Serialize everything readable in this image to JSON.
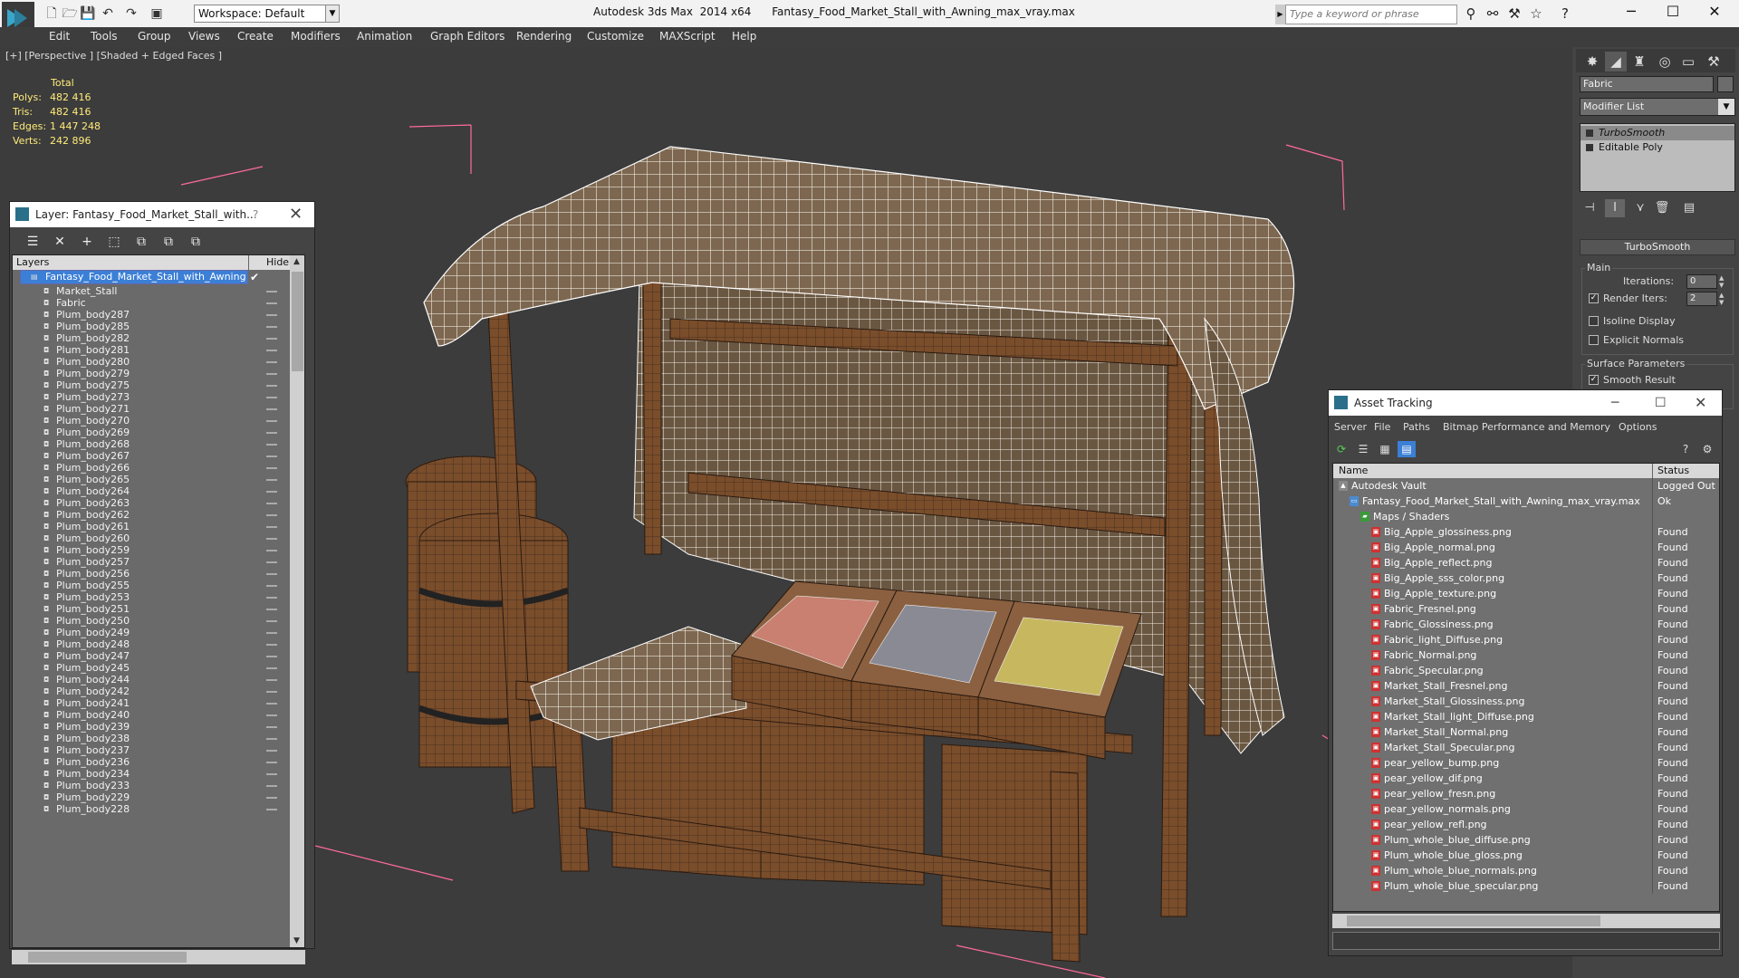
{
  "titlebar": {
    "workspace": "Workspace: Default",
    "app_title": "Autodesk 3ds Max  2014 x64",
    "file_title": "Fantasy_Food_Market_Stall_with_Awning_max_vray.max",
    "search_placeholder": "Type a keyword or phrase",
    "minimize": "─",
    "maximize": "☐",
    "close": "✕"
  },
  "menu": [
    "Edit",
    "Tools",
    "Group",
    "Views",
    "Create",
    "Modifiers",
    "Animation",
    "Graph Editors",
    "Rendering",
    "Customize",
    "MAXScript",
    "Help"
  ],
  "viewport": {
    "label": "[+] [Perspective ] [Shaded + Edged Faces ]",
    "stats_header": "Total",
    "stats": [
      {
        "k": "Polys:",
        "v": "482 416"
      },
      {
        "k": "Tris:",
        "v": "482 416"
      },
      {
        "k": "Edges:",
        "v": "1 447 248"
      },
      {
        "k": "Verts:",
        "v": "242 896"
      }
    ]
  },
  "command_panel": {
    "object_name": "Fabric",
    "modifier_list": "Modifier List",
    "stack": [
      {
        "label": "TurboSmooth",
        "selected": true
      },
      {
        "label": "Editable Poly",
        "selected": false
      }
    ],
    "rollout_title": "TurboSmooth",
    "main_group": "Main",
    "iterations_label": "Iterations:",
    "iterations_value": "0",
    "render_iters_label": "Render Iters:",
    "render_iters_value": "2",
    "isoline_label": "Isoline Display",
    "explicit_label": "Explicit Normals",
    "surface_group": "Surface Parameters",
    "smooth_label": "Smooth Result",
    "check_mark": "✓"
  },
  "layer_panel": {
    "title": "Layer:  Fantasy_Food_Market_Stall_with...",
    "help": "?",
    "close": "✕",
    "col_layers": "Layers",
    "col_hide": "Hide",
    "root_layer": "Fantasy_Food_Market_Stall_with_Awning",
    "items": [
      "Market_Stall",
      "Fabric",
      "Plum_body287",
      "Plum_body285",
      "Plum_body282",
      "Plum_body281",
      "Plum_body280",
      "Plum_body279",
      "Plum_body275",
      "Plum_body273",
      "Plum_body271",
      "Plum_body270",
      "Plum_body269",
      "Plum_body268",
      "Plum_body267",
      "Plum_body266",
      "Plum_body265",
      "Plum_body264",
      "Plum_body263",
      "Plum_body262",
      "Plum_body261",
      "Plum_body260",
      "Plum_body259",
      "Plum_body257",
      "Plum_body256",
      "Plum_body255",
      "Plum_body253",
      "Plum_body251",
      "Plum_body250",
      "Plum_body249",
      "Plum_body248",
      "Plum_body247",
      "Plum_body245",
      "Plum_body244",
      "Plum_body242",
      "Plum_body241",
      "Plum_body240",
      "Plum_body239",
      "Plum_body238",
      "Plum_body237",
      "Plum_body236",
      "Plum_body234",
      "Plum_body233",
      "Plum_body229",
      "Plum_body228"
    ]
  },
  "asset_tracking": {
    "title": "Asset Tracking",
    "menu": [
      "Server",
      "File",
      "Paths",
      "Bitmap Performance and Memory",
      "Options"
    ],
    "col_name": "Name",
    "col_status": "Status",
    "rows": [
      {
        "name": "Autodesk Vault",
        "status": "Logged Out",
        "level": 0
      },
      {
        "name": "Fantasy_Food_Market_Stall_with_Awning_max_vray.max",
        "status": "Ok",
        "level": 1
      },
      {
        "name": "Maps / Shaders",
        "status": "",
        "level": 2
      },
      {
        "name": "Big_Apple_glossiness.png",
        "status": "Found",
        "level": 3
      },
      {
        "name": "Big_Apple_normal.png",
        "status": "Found",
        "level": 3
      },
      {
        "name": "Big_Apple_reflect.png",
        "status": "Found",
        "level": 3
      },
      {
        "name": "Big_Apple_sss_color.png",
        "status": "Found",
        "level": 3
      },
      {
        "name": "Big_Apple_texture.png",
        "status": "Found",
        "level": 3
      },
      {
        "name": "Fabric_Fresnel.png",
        "status": "Found",
        "level": 3
      },
      {
        "name": "Fabric_Glossiness.png",
        "status": "Found",
        "level": 3
      },
      {
        "name": "Fabric_light_Diffuse.png",
        "status": "Found",
        "level": 3
      },
      {
        "name": "Fabric_Normal.png",
        "status": "Found",
        "level": 3
      },
      {
        "name": "Fabric_Specular.png",
        "status": "Found",
        "level": 3
      },
      {
        "name": "Market_Stall_Fresnel.png",
        "status": "Found",
        "level": 3
      },
      {
        "name": "Market_Stall_Glossiness.png",
        "status": "Found",
        "level": 3
      },
      {
        "name": "Market_Stall_light_Diffuse.png",
        "status": "Found",
        "level": 3
      },
      {
        "name": "Market_Stall_Normal.png",
        "status": "Found",
        "level": 3
      },
      {
        "name": "Market_Stall_Specular.png",
        "status": "Found",
        "level": 3
      },
      {
        "name": "pear_yellow_bump.png",
        "status": "Found",
        "level": 3
      },
      {
        "name": "pear_yellow_dif.png",
        "status": "Found",
        "level": 3
      },
      {
        "name": "pear_yellow_fresn.png",
        "status": "Found",
        "level": 3
      },
      {
        "name": "pear_yellow_normals.png",
        "status": "Found",
        "level": 3
      },
      {
        "name": "pear_yellow_refl.png",
        "status": "Found",
        "level": 3
      },
      {
        "name": "Plum_whole_blue_diffuse.png",
        "status": "Found",
        "level": 3
      },
      {
        "name": "Plum_whole_blue_gloss.png",
        "status": "Found",
        "level": 3
      },
      {
        "name": "Plum_whole_blue_normals.png",
        "status": "Found",
        "level": 3
      },
      {
        "name": "Plum_whole_blue_specular.png",
        "status": "Found",
        "level": 3
      }
    ]
  },
  "colors": {
    "stats_text": "#ffeb7a",
    "selection": "#3b7fd6",
    "viewport_bg": "#3c3c3c",
    "wire": "#ffffff",
    "bbox": "#ff6b9a"
  }
}
